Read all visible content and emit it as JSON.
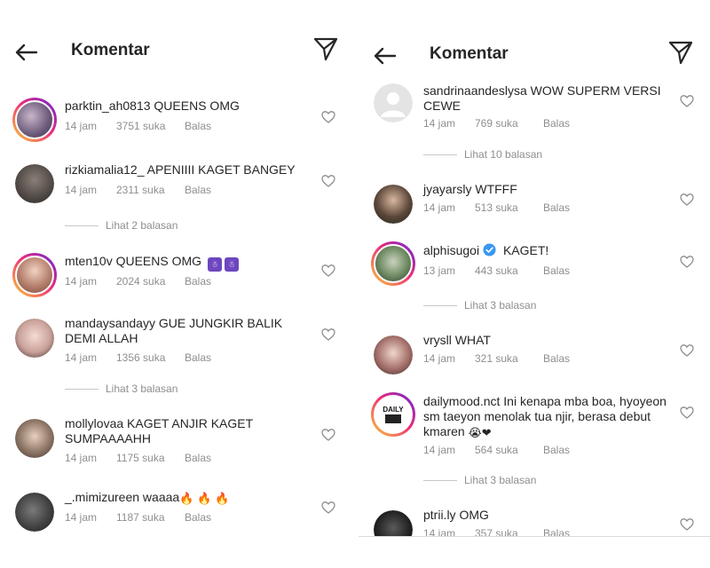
{
  "left": {
    "header": {
      "title": "Komentar"
    },
    "comments": [
      {
        "username": "parktin_ah0813",
        "text": "QUEENS OMG",
        "time": "14 jam",
        "likes": "3751 suka",
        "reply": "Balas"
      },
      {
        "username": "rizkiamalia12_",
        "text": "APENIIII KAGET BANGEY",
        "time": "14 jam",
        "likes": "2311 suka",
        "reply": "Balas"
      },
      {
        "username": "mten10v",
        "text": "QUEENS OMG",
        "time": "14 jam",
        "likes": "2024 suka",
        "reply": "Balas"
      },
      {
        "username": "mandaysandayy",
        "text": "GUE JUNGKIR BALIK DEMI ALLAH",
        "time": "14 jam",
        "likes": "1356 suka",
        "reply": "Balas"
      },
      {
        "username": "mollylovaa",
        "text": "KAGET ANJIR KAGET SUMPAAAAHH",
        "time": "14 jam",
        "likes": "1175 suka",
        "reply": "Balas"
      },
      {
        "username": "_.mimizureen",
        "text": "waaaa",
        "time": "14 jam",
        "likes": "1187 suka",
        "reply": "Balas"
      }
    ],
    "view_replies": [
      "Lihat 2 balasan",
      "Lihat 3 balasan"
    ]
  },
  "right": {
    "header": {
      "title": "Komentar"
    },
    "comments": [
      {
        "username": "sandrinaandeslysa",
        "text": "WOW SUPERM VERSI CEWE",
        "time": "14 jam",
        "likes": "769 suka",
        "reply": "Balas"
      },
      {
        "username": "jyayarsly",
        "text": "WTFFF",
        "time": "14 jam",
        "likes": "513 suka",
        "reply": "Balas"
      },
      {
        "username": "alphisugoi",
        "text": "KAGET!",
        "time": "13 jam",
        "likes": "443 suka",
        "reply": "Balas"
      },
      {
        "username": "vrysll",
        "text": "WHAT",
        "time": "14 jam",
        "likes": "321 suka",
        "reply": "Balas"
      },
      {
        "username": "dailymood.nct",
        "text": "Ini kenapa mba boa, hyoyeon sm taeyon menolak tua njir, berasa debut kmaren",
        "time": "14 jam",
        "likes": "564 suka",
        "reply": "Balas"
      },
      {
        "username": "ptrii.ly",
        "text": "OMG",
        "time": "14 jam",
        "likes": "357 suka",
        "reply": "Balas"
      }
    ],
    "view_replies": [
      "Lihat 10 balasan",
      "Lihat 3 balasan",
      "Lihat 3 balasan"
    ]
  },
  "avatar_labels": {
    "dailymood": "DAILY"
  },
  "colors": {
    "text": "#262626",
    "muted": "#8e8e8e",
    "verified": "#3897f0",
    "story_ring_start": "#f9ce34",
    "story_ring_end": "#ee2a7b"
  },
  "icons": {
    "back": "arrow-left-icon",
    "send": "paper-plane-icon",
    "like": "heart-outline-icon",
    "verified": "verified-badge-icon",
    "fire": "fire-emoji",
    "crying": "crying-face-emoji",
    "heart_emoji": "black-heart-emoji"
  }
}
